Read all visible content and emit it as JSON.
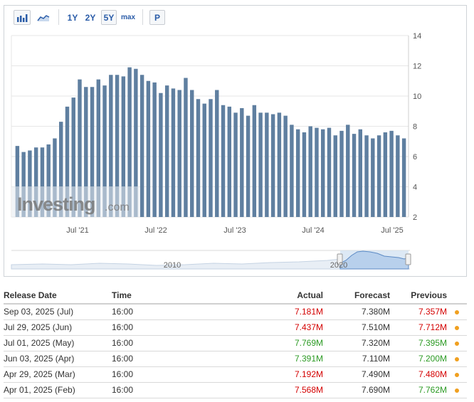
{
  "toolbar": {
    "range_buttons": [
      "1Y",
      "2Y",
      "5Y",
      "max"
    ],
    "selected_range": "5Y",
    "p_button": "P"
  },
  "watermark": {
    "brand": "Investing",
    "suffix": ".com"
  },
  "navigator": {
    "labels": [
      "2010",
      "2020"
    ]
  },
  "chart_data": {
    "type": "bar",
    "x_ticks": [
      "Jul '21",
      "Jul '22",
      "Jul '23",
      "Jul '24",
      "Jul '25"
    ],
    "y_ticks": [
      2,
      4,
      6,
      8,
      10,
      12,
      14
    ],
    "ylim": [
      2,
      14
    ],
    "grid": true,
    "bar_color": "#5f7fa0",
    "values": [
      6.7,
      6.3,
      6.4,
      6.6,
      6.6,
      6.8,
      7.2,
      8.3,
      9.3,
      9.9,
      11.1,
      10.6,
      10.6,
      11.1,
      10.7,
      11.4,
      11.4,
      11.3,
      11.9,
      11.8,
      11.4,
      11.0,
      10.9,
      10.2,
      10.7,
      10.5,
      10.4,
      11.2,
      10.4,
      9.8,
      9.5,
      9.8,
      10.4,
      9.4,
      9.3,
      8.9,
      9.2,
      8.7,
      9.4,
      8.9,
      8.9,
      8.8,
      8.9,
      8.7,
      8.1,
      7.8,
      7.6,
      8.0,
      7.9,
      7.8,
      7.9,
      7.4,
      7.7,
      8.1,
      7.5,
      7.8,
      7.4,
      7.2,
      7.4,
      7.6,
      7.7,
      7.4,
      7.2
    ]
  },
  "table": {
    "headers": {
      "date": "Release Date",
      "time": "Time",
      "actual": "Actual",
      "forecast": "Forecast",
      "previous": "Previous"
    },
    "rows": [
      {
        "date": "Sep 03, 2025 (Jul)",
        "time": "16:00",
        "actual": "7.181M",
        "actual_trend": "neg",
        "forecast": "7.380M",
        "previous": "7.357M",
        "previous_trend": "neg"
      },
      {
        "date": "Jul 29, 2025 (Jun)",
        "time": "16:00",
        "actual": "7.437M",
        "actual_trend": "neg",
        "forecast": "7.510M",
        "previous": "7.712M",
        "previous_trend": "neg"
      },
      {
        "date": "Jul 01, 2025 (May)",
        "time": "16:00",
        "actual": "7.769M",
        "actual_trend": "pos",
        "forecast": "7.320M",
        "previous": "7.395M",
        "previous_trend": "pos"
      },
      {
        "date": "Jun 03, 2025 (Apr)",
        "time": "16:00",
        "actual": "7.391M",
        "actual_trend": "pos",
        "forecast": "7.110M",
        "previous": "7.200M",
        "previous_trend": "pos"
      },
      {
        "date": "Apr 29, 2025 (Mar)",
        "time": "16:00",
        "actual": "7.192M",
        "actual_trend": "neg",
        "forecast": "7.490M",
        "previous": "7.480M",
        "previous_trend": "neg"
      },
      {
        "date": "Apr 01, 2025 (Feb)",
        "time": "16:00",
        "actual": "7.568M",
        "actual_trend": "neg",
        "forecast": "7.690M",
        "previous": "7.762M",
        "previous_trend": "pos"
      }
    ]
  },
  "colors": {
    "accent": "#2a5ca8",
    "positive": "#2b9a23",
    "negative": "#d40000",
    "alert_dot": "#f0a020"
  }
}
